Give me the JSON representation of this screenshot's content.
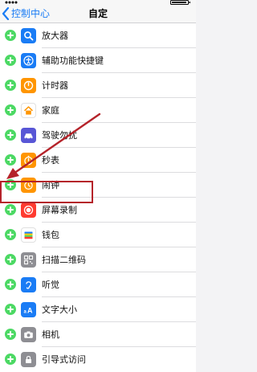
{
  "nav": {
    "back_label": "控制中心",
    "title": "自定"
  },
  "list": {
    "items": [
      {
        "label": "放大器",
        "icon": "magnifier-icon",
        "color": "#1a7cf5"
      },
      {
        "label": "辅助功能快捷键",
        "icon": "accessibility-icon",
        "color": "#1a7cf5"
      },
      {
        "label": "计时器",
        "icon": "timer-icon",
        "color": "#ff9500"
      },
      {
        "label": "家庭",
        "icon": "home-icon",
        "color": "#ff9500"
      },
      {
        "label": "驾驶勿扰",
        "icon": "car-icon",
        "color": "#5856d6"
      },
      {
        "label": "秒表",
        "icon": "stopwatch-icon",
        "color": "#ff9500"
      },
      {
        "label": "闹钟",
        "icon": "alarm-icon",
        "color": "#ff9500"
      },
      {
        "label": "屏幕录制",
        "icon": "screen-record-icon",
        "color": "#ff3b30"
      },
      {
        "label": "钱包",
        "icon": "wallet-icon",
        "color": "#4cd964"
      },
      {
        "label": "扫描二维码",
        "icon": "qr-code-icon",
        "color": "#8e8e93"
      },
      {
        "label": "听觉",
        "icon": "ear-icon",
        "color": "#1a7cf5"
      },
      {
        "label": "文字大小",
        "icon": "text-size-icon",
        "color": "#1a7cf5"
      },
      {
        "label": "相机",
        "icon": "camera-icon",
        "color": "#8e8e93"
      },
      {
        "label": "引导式访问",
        "icon": "lock-icon",
        "color": "#8e8e93"
      }
    ]
  },
  "colors": {
    "accent": "#1a7cf5",
    "highlight": "#b5232a",
    "add_button": "#4cd964"
  }
}
